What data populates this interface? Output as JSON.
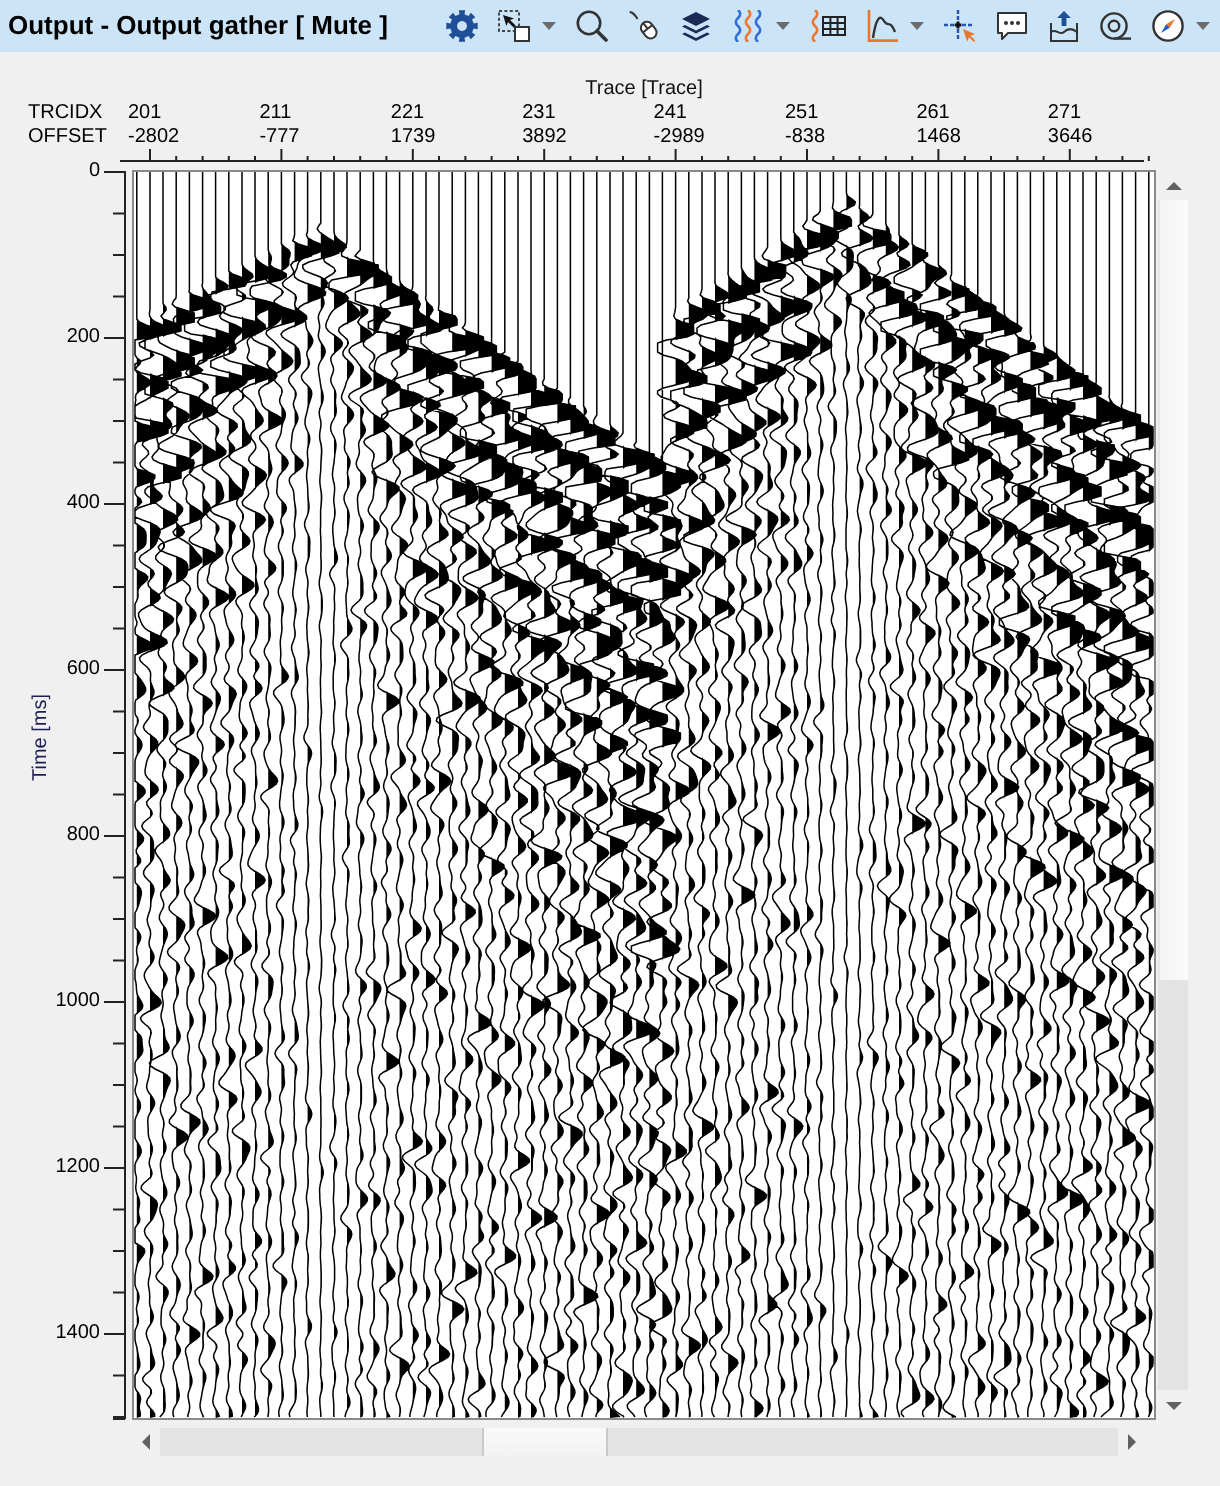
{
  "window": {
    "title": "Output - Output gather [ Mute ]"
  },
  "x_axis": {
    "title": "Trace [Trace]",
    "rows": [
      {
        "label": "TRCIDX",
        "values": [
          "201",
          "211",
          "221",
          "231",
          "241",
          "251",
          "261",
          "271"
        ]
      },
      {
        "label": "OFFSET",
        "values": [
          "-2802",
          "-777",
          "1739",
          "3892",
          "-2989",
          "-838",
          "1468",
          "3646"
        ]
      }
    ]
  },
  "y_axis": {
    "title": "Time [ms]",
    "ticks": [
      "0",
      "200",
      "400",
      "600",
      "800",
      "1000",
      "1200",
      "1400"
    ]
  }
}
